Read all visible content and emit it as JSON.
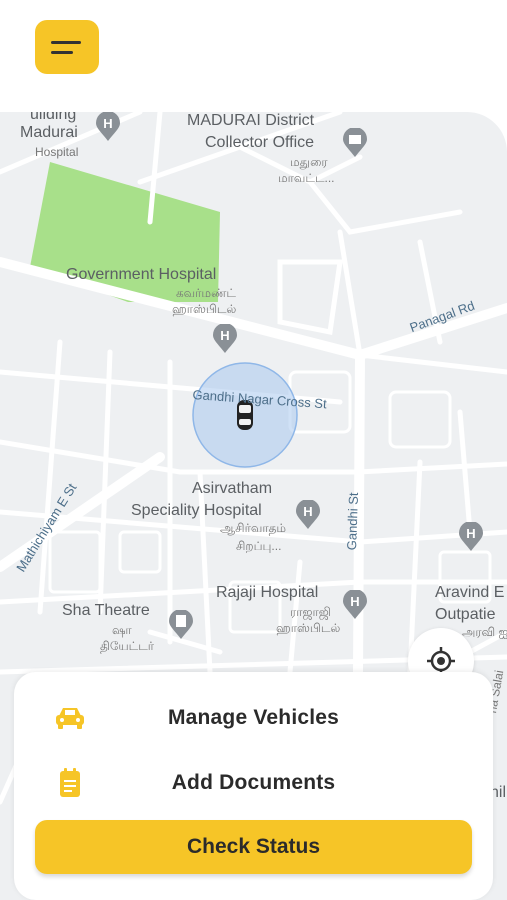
{
  "header": {
    "menu_icon": "menu-icon"
  },
  "map": {
    "labels": {
      "madurai_building": "uilding",
      "madurai": "Madurai",
      "hospital": "Hospital",
      "collector_line1": "MADURAI District",
      "collector_line2": "Collector Office",
      "collector_tamil1": "மதுரை",
      "collector_tamil2": "மாவட்ட...",
      "gov_hospital": "Government Hospital",
      "gov_tamil1": "கவர்மண்ட்",
      "gov_tamil2": "ஹாஸ்பிடல்",
      "panagal": "Panagal Rd",
      "gandhi_cross": "Gandhi Nagar Cross St",
      "mathichiyam": "Mathichiyam E St",
      "asirvatham1": "Asirvatham",
      "asirvatham2": "Speciality Hospital",
      "asirvatham_tamil1": "ஆசிர்வாதம்",
      "asirvatham_tamil2": "சிறப்பு...",
      "gandhi_st": "Gandhi St",
      "rajaji": "Rajaji Hospital",
      "rajaji_tamil1": "ராஜாஜி",
      "rajaji_tamil2": "ஹாஸ்பிடல்",
      "aravind1": "Aravind E",
      "aravind2": "Outpatie",
      "aravind_tamil": "அரவி ஐ",
      "sha_theatre": "Sha Theatre",
      "sha_tamil1": "ஷா",
      "sha_tamil2": "தியேட்டர்",
      "salai": "na Salai",
      "edge_text": "nil"
    }
  },
  "sheet": {
    "manage_vehicles": "Manage Vehicles",
    "add_documents": "Add Documents",
    "check_status": "Check Status"
  },
  "colors": {
    "accent": "#f6c527",
    "park": "#a8e08a",
    "radius": "#a9c9ef"
  }
}
